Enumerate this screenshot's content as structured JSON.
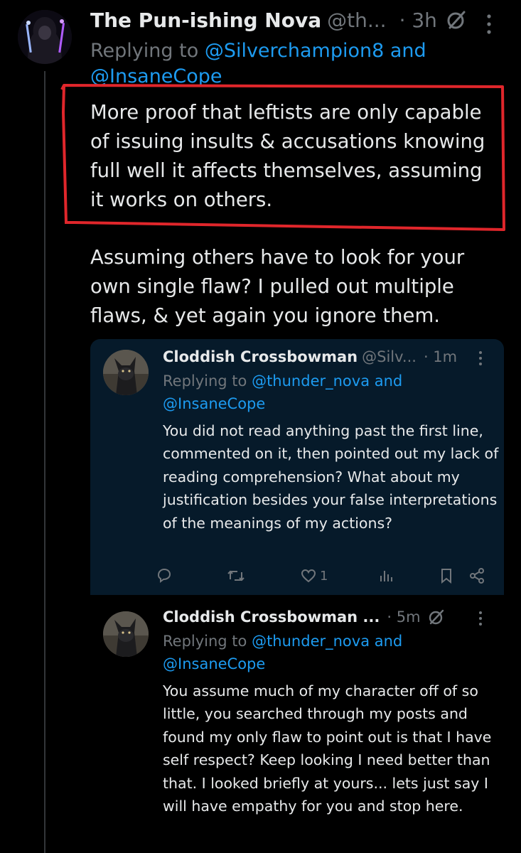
{
  "main_tweet": {
    "author_name": "The Pun-ishing Nova",
    "author_handle": "@th...",
    "time": "· 3h",
    "replying_prefix": "Replying to ",
    "replying_user1": "@Silverchampion8 and",
    "replying_user2": "@InsaneCope",
    "text_highlighted": "More proof that leftists are only capable of issuing insults & accusations knowing full well it affects themselves, assuming it works on others.",
    "text_second": "Assuming others have to look for your own single flaw? I pulled out multiple flaws, & yet again you ignore them."
  },
  "reply_1": {
    "author_name": "Cloddish Crossbowman",
    "author_handle": "@Silv...",
    "time": "· 1m",
    "replying_prefix": "Replying to ",
    "replying_user1": "@thunder_nova and",
    "replying_user2": "@InsaneCope",
    "text": "You did not read anything past the first line, commented on it, then pointed out my lack of reading comprehension? What about my justification besides your false interpretations of the meanings of my actions?",
    "like_count": "1"
  },
  "reply_2": {
    "author_name": "Cloddish Crossbowman ...",
    "time": "· 5m",
    "replying_prefix": "Replying to ",
    "replying_user1": "@thunder_nova and",
    "replying_user2": "@InsaneCope",
    "text": "You assume much of my character off  of so little, you searched through my posts and found my only flaw to point out is that I have self respect? Keep looking I need better than that. I looked briefly at yours... lets just say I will have empathy for you and stop here."
  },
  "colors": {
    "background": "#000000",
    "text_primary": "#e7e9ea",
    "text_secondary": "#71767b",
    "link": "#1d9bf0",
    "highlight_annotation": "#e0262b",
    "quote_background": "#061a2a"
  },
  "icons": [
    "ghost-icon",
    "more-icon",
    "reply-icon",
    "repost-icon",
    "like-icon",
    "views-icon",
    "bookmark-icon",
    "share-icon"
  ]
}
